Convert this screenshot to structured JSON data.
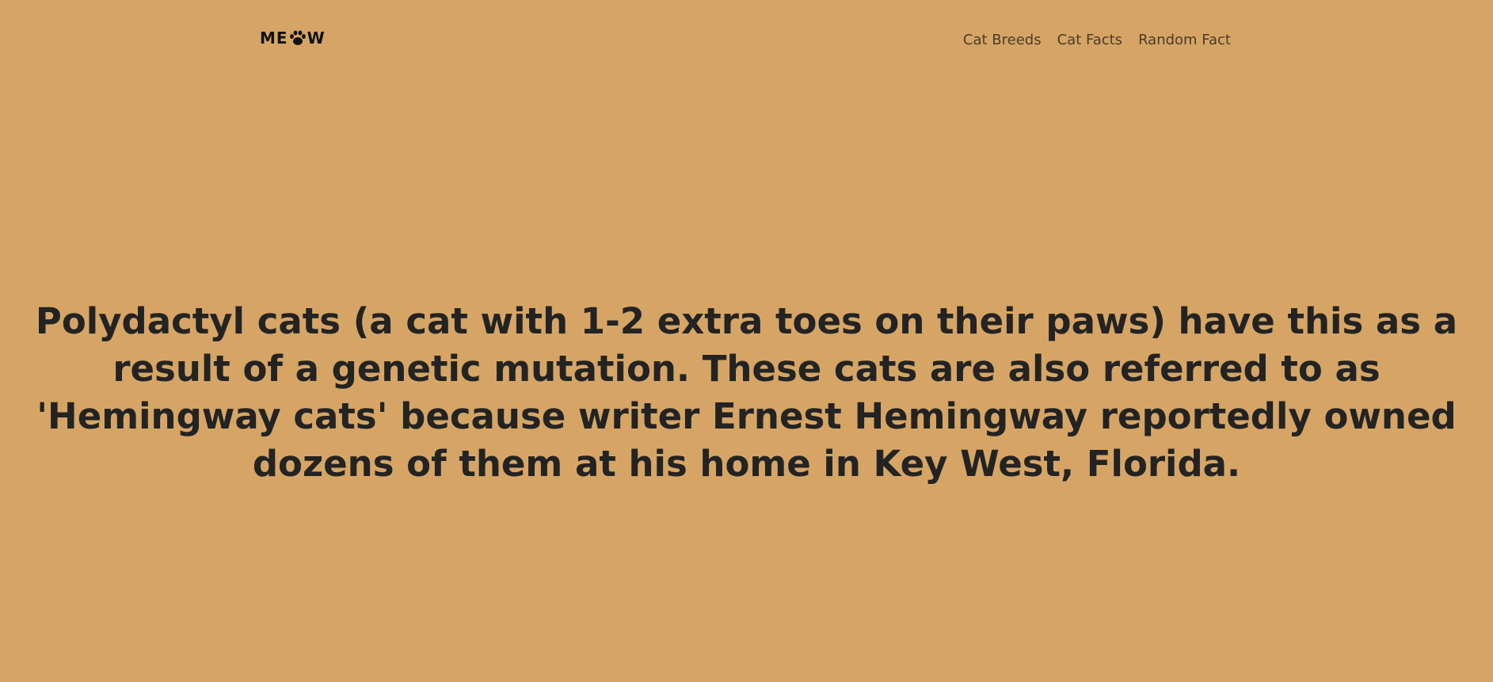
{
  "brand": {
    "logo_left": "ME",
    "logo_icon": "paw-print-icon",
    "logo_right": "W"
  },
  "nav": {
    "items": [
      {
        "label": "Cat Breeds"
      },
      {
        "label": "Cat Facts"
      },
      {
        "label": "Random Fact"
      }
    ]
  },
  "main": {
    "fact": "Polydactyl cats (a cat with 1-2 extra toes on their paws) have this as a result of a genetic mutation. These cats are also referred to as 'Hemingway cats' because writer Ernest Hemingway reportedly owned dozens of them at his home in Key West, Florida."
  },
  "colors": {
    "background": "#d6a565",
    "text": "#232323",
    "nav_text": "#4a3b2a"
  }
}
